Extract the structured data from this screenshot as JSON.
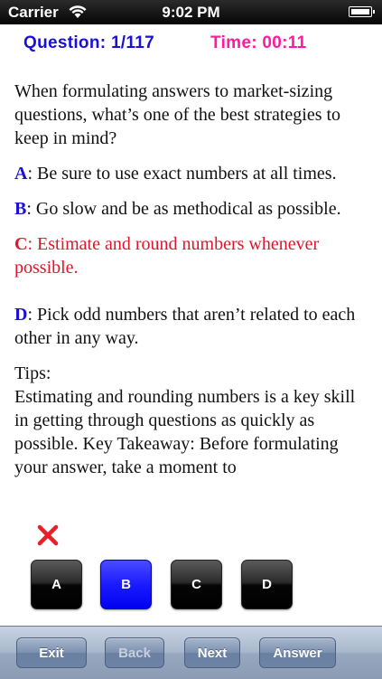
{
  "status_bar": {
    "carrier": "Carrier",
    "time": "9:02 PM",
    "icons": [
      "wifi-icon",
      "battery-icon"
    ]
  },
  "header": {
    "question_label": "Question:  1/117",
    "time_label": "Time:  00:11"
  },
  "question": {
    "text": "When formulating answers to market-sizing questions, what’s one of the best strategies to keep in mind?",
    "options": [
      {
        "letter": "A",
        "text": ": Be sure to use exact numbers at all times."
      },
      {
        "letter": "B",
        "text": ": Go slow and be as methodical as possible."
      },
      {
        "letter": "C",
        "text": ": Estimate and round numbers whenever possible."
      },
      {
        "letter": "D",
        "text": ": Pick odd numbers that aren’t related to each other in any way."
      }
    ],
    "tips_title": "Tips:",
    "tips_text": "Estimating and rounding numbers is a key skill in getting through questions as quickly as possible. Key Takeaway: Before formulating your answer, take a moment to"
  },
  "answer_buttons": [
    {
      "label": "A"
    },
    {
      "label": "B",
      "selected": true
    },
    {
      "label": "C"
    },
    {
      "label": "D"
    }
  ],
  "toolbar": {
    "exit_label": "Exit",
    "back_label": "Back",
    "next_label": "Next",
    "answer_label": "Answer"
  },
  "colors": {
    "question_label": "#1a10d8",
    "time_label": "#ff1aa0",
    "correct_option": "#e0152b",
    "selected_button": "#1b1bff",
    "wrong_mark": "#e8202a"
  }
}
